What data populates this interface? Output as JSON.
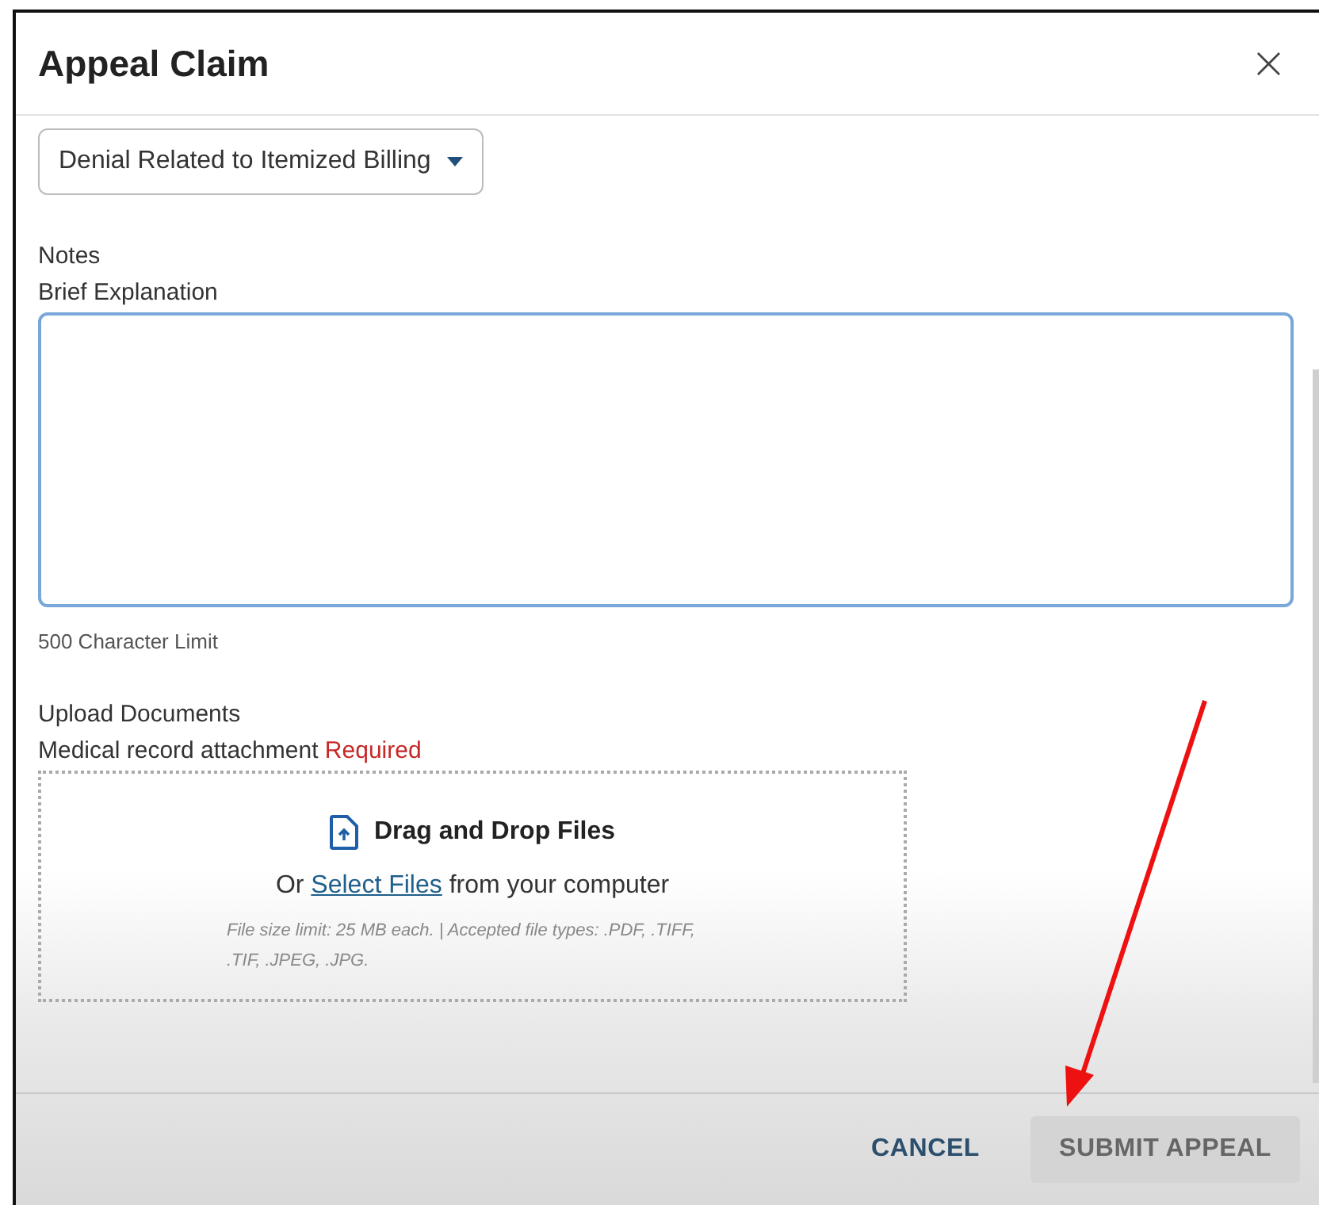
{
  "dialog": {
    "title": "Appeal Claim",
    "close": "×"
  },
  "appeal_type": {
    "value": "Denial Related to Itemized Billing"
  },
  "notes": {
    "heading": "Notes",
    "label": "Brief Explanation",
    "focused": true,
    "hint": "500 Character Limit"
  },
  "upload": {
    "heading": "Upload Documents",
    "label": "Medical record attachment",
    "required": "Required",
    "drop_title": "Drag and Drop Files",
    "select_prefix": "Or",
    "select_link": "Select Files",
    "select_suffix": "from your computer",
    "limits": "File size limit: 25 MB each. | Accepted file types: .PDF, .TIFF, .TIF, .JPEG, .JPG."
  },
  "buttons": [
    {
      "label": "CANCEL",
      "kind": "text",
      "disabled": false
    },
    {
      "label": "SUBMIT APPEAL",
      "kind": "contained",
      "disabled": true
    }
  ],
  "annotation": {
    "kind": "arrow"
  }
}
